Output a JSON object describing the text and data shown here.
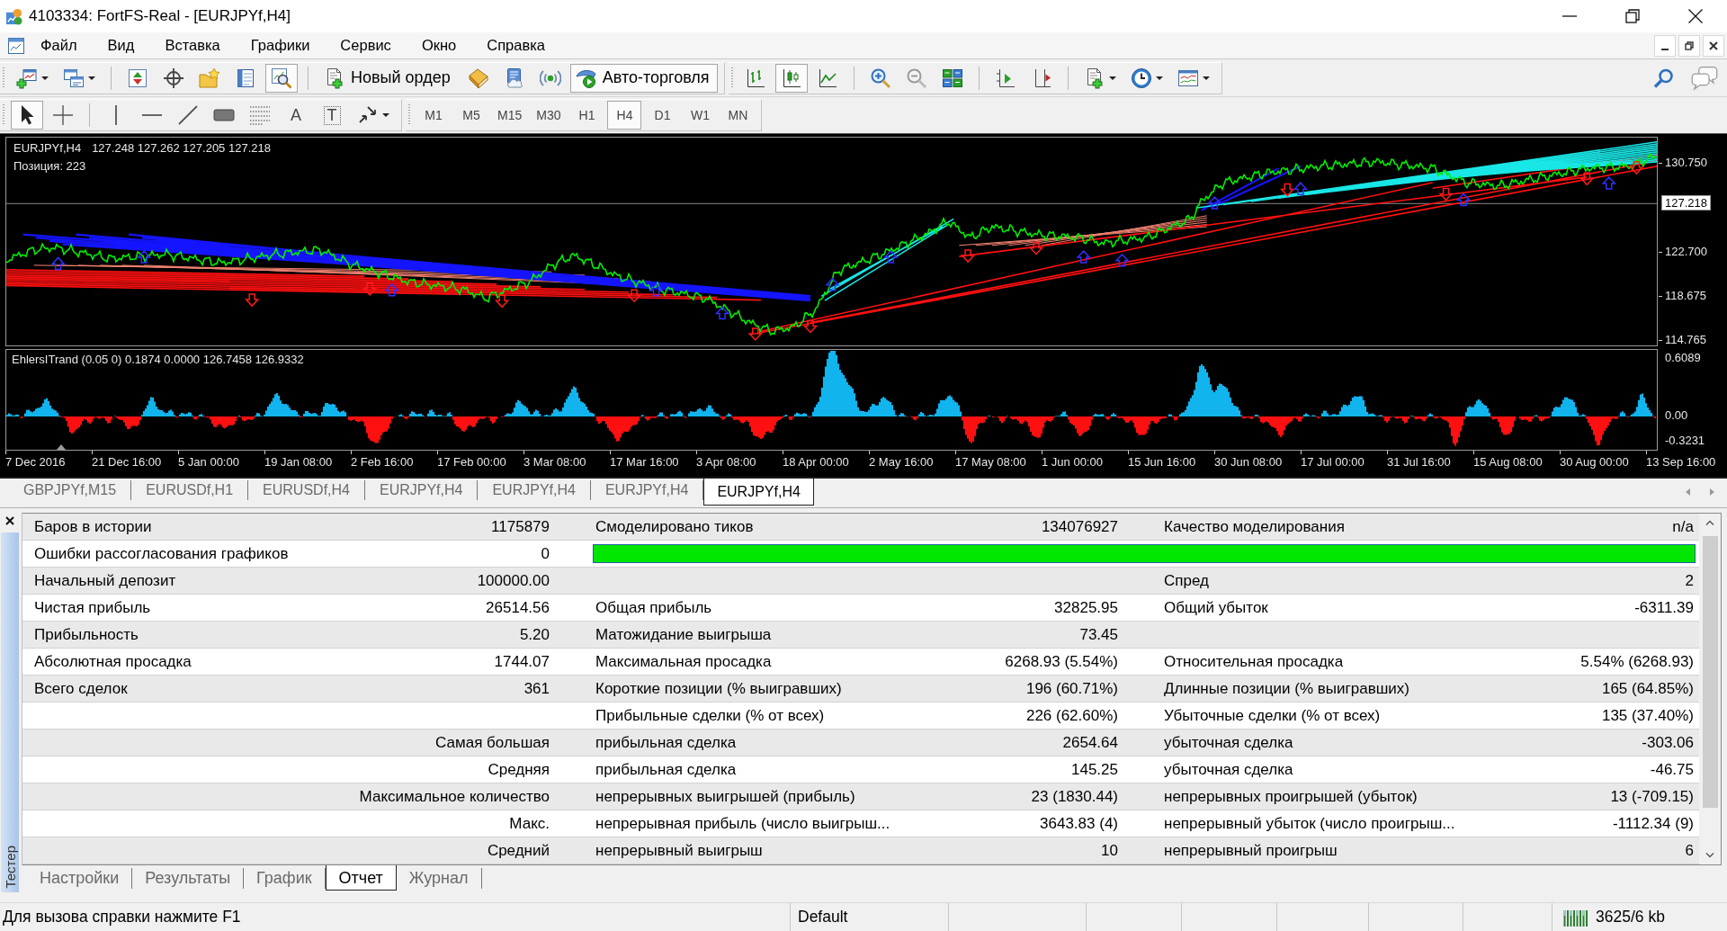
{
  "window": {
    "title": "4103334: FortFS-Real - [EURJPYf,H4]"
  },
  "menu": [
    "Файл",
    "Вид",
    "Вставка",
    "Графики",
    "Сервис",
    "Окно",
    "Справка"
  ],
  "toolbar_rows": [
    [
      {
        "groups": [
          [
            {
              "kind": "new_chart",
              "dropdown": true,
              "pressed": false
            },
            {
              "kind": "profiles",
              "dropdown": true,
              "pressed": false
            }
          ],
          [
            {
              "kind": "market_watch",
              "pressed": false
            },
            {
              "kind": "data_window",
              "pressed": false
            },
            {
              "kind": "navigator",
              "pressed": false
            },
            {
              "kind": "terminal",
              "pressed": false
            },
            {
              "kind": "tester",
              "pressed": true
            }
          ],
          [
            {
              "kind": "new_order",
              "label": "Новый ордер",
              "pressed": false
            },
            {
              "kind": "editor",
              "pressed": false
            },
            {
              "kind": "market",
              "pressed": false
            },
            {
              "kind": "signals",
              "pressed": false
            },
            {
              "kind": "auto_trading",
              "label": "Авто-торговля",
              "pressed": true
            }
          ]
        ]
      },
      {
        "groups": [
          [
            {
              "kind": "bar_chart",
              "pressed": false
            },
            {
              "kind": "candles",
              "pressed": true
            },
            {
              "kind": "line_chart",
              "pressed": false
            }
          ],
          [
            {
              "kind": "zoom_in",
              "pressed": false
            },
            {
              "kind": "zoom_out",
              "pressed": false
            },
            {
              "kind": "tile",
              "pressed": false
            }
          ],
          [
            {
              "kind": "chart_shift",
              "pressed": false
            },
            {
              "kind": "auto_scroll",
              "pressed": false
            }
          ],
          [
            {
              "kind": "indicators",
              "dropdown": true,
              "pressed": false
            },
            {
              "kind": "periods",
              "dropdown": true,
              "pressed": false
            },
            {
              "kind": "templates",
              "dropdown": true,
              "pressed": false
            }
          ]
        ]
      }
    ],
    [
      {
        "groups": [
          [
            {
              "kind": "cursor",
              "pressed": true
            },
            {
              "kind": "crosshair",
              "pressed": false
            }
          ],
          [
            {
              "kind": "vertical_line",
              "pressed": false
            },
            {
              "kind": "horizontal_line",
              "pressed": false
            },
            {
              "kind": "trend_line",
              "pressed": false
            },
            {
              "kind": "rectangle",
              "pressed": false
            },
            {
              "kind": "fibonacci",
              "pressed": false
            },
            {
              "kind": "text",
              "glyph": "A",
              "pressed": false
            },
            {
              "kind": "text_label",
              "glyph": "T",
              "pressed": false
            },
            {
              "kind": "arrows",
              "dropdown": true,
              "pressed": false
            }
          ]
        ]
      },
      {
        "groups": [
          [
            {
              "kind": "timeframe",
              "label": "M1",
              "selected": false
            },
            {
              "kind": "timeframe",
              "label": "M5",
              "selected": false
            },
            {
              "kind": "timeframe",
              "label": "M15",
              "selected": false
            },
            {
              "kind": "timeframe",
              "label": "M30",
              "selected": false
            },
            {
              "kind": "timeframe",
              "label": "H1",
              "selected": false
            },
            {
              "kind": "timeframe",
              "label": "H4",
              "selected": true
            },
            {
              "kind": "timeframe",
              "label": "D1",
              "selected": false
            },
            {
              "kind": "timeframe",
              "label": "W1",
              "selected": false
            },
            {
              "kind": "timeframe",
              "label": "MN",
              "selected": false
            }
          ]
        ]
      }
    ]
  ],
  "chart": {
    "symbol": "EURJPYf,H4",
    "quote": "127.248 127.262 127.205 127.218",
    "position": "Позиция: 223",
    "price_labels": [
      "130.750",
      "122.700",
      "118.675",
      "114.765"
    ],
    "current_price": "127.218",
    "indicator": {
      "label": "EhlersITrand (0.05 0) 0.1874 0.0000 126.7458 126.9332",
      "axis_labels": [
        "0.6089",
        "0.00",
        "-0.3231"
      ]
    },
    "time_labels": [
      "7 Dec 2016",
      "21 Dec 16:00",
      "5 Jan 00:00",
      "19 Jan 08:00",
      "2 Feb 16:00",
      "17 Feb 00:00",
      "3 Mar 08:00",
      "17 Mar 16:00",
      "3 Apr 08:00",
      "18 Apr 00:00",
      "2 May 16:00",
      "17 May 08:00",
      "1 Jun 00:00",
      "15 Jun 16:00",
      "30 Jun 08:00",
      "17 Jul 00:00",
      "31 Jul 16:00",
      "15 Aug 08:00",
      "30 Aug 00:00",
      "13 Sep 16:00"
    ]
  },
  "chart_tabs": [
    {
      "label": "GBPJPYf,M15",
      "selected": false
    },
    {
      "label": "EURUSDf,H1",
      "selected": false
    },
    {
      "label": "EURUSDf,H4",
      "selected": false
    },
    {
      "label": "EURJPYf,H4",
      "selected": false
    },
    {
      "label": "EURJPYf,H4",
      "selected": false
    },
    {
      "label": "EURJPYf,H4",
      "selected": false
    },
    {
      "label": "EURJPYf,H4",
      "selected": true
    }
  ],
  "tester": {
    "title": "Тестер",
    "report": {
      "rows": [
        {
          "col_1": {
            "label": "Баров в истории",
            "value": "1175879"
          },
          "col_2": {
            "label": "Смоделировано тиков",
            "value": "134076927"
          },
          "col_3": {
            "label": "Качество моделирования",
            "value": "n/a"
          }
        },
        {
          "col_1": {
            "label": "Ошибки рассогласования графиков",
            "value": "0"
          },
          "quality_bar": {
            "level": 1
          }
        },
        {
          "col_1": {
            "label": "Начальный депозит",
            "value": "100000.00"
          },
          "col_3": {
            "label": "Спред",
            "value": "2"
          }
        },
        {
          "col_1": {
            "label": "Чистая прибыль",
            "value": "26514.56"
          },
          "col_2": {
            "label": "Общая прибыль",
            "value": "32825.95"
          },
          "col_3": {
            "label": "Общий убыток",
            "value": "-6311.39"
          }
        },
        {
          "col_1": {
            "label": "Прибыльность",
            "value": "5.20"
          },
          "col_2": {
            "label": "Матожидание выигрыша",
            "value": "73.45"
          }
        },
        {
          "col_1": {
            "label": "Абсолютная просадка",
            "value": "1744.07"
          },
          "col_2": {
            "label": "Максимальная просадка",
            "value": "6268.93 (5.54%)"
          },
          "col_3": {
            "label": "Относительная просадка",
            "value": "5.54% (6268.93)"
          }
        },
        {
          "col_1": {
            "label": "Всего сделок",
            "value": "361"
          },
          "col_2": {
            "label": "Короткие позиции (% выигравших)",
            "value": "196 (60.71%)"
          },
          "col_3": {
            "label": "Длинные позиции (% выигравших)",
            "value": "165 (64.85%)"
          }
        },
        {
          "col_2": {
            "label": "Прибыльные сделки (% от всех)",
            "value": "226 (62.60%)"
          },
          "col_3": {
            "label": "Убыточные сделки (% от всех)",
            "value": "135 (37.40%)"
          }
        },
        {
          "caption": "Самая большая",
          "col_2": {
            "label": "прибыльная сделка",
            "value": "2654.64"
          },
          "col_3": {
            "label": "убыточная сделка",
            "value": "-303.06"
          }
        },
        {
          "caption": "Средняя",
          "col_2": {
            "label": "прибыльная сделка",
            "value": "145.25"
          },
          "col_3": {
            "label": "убыточная сделка",
            "value": "-46.75"
          }
        },
        {
          "caption": "Максимальное количество",
          "col_2": {
            "label": "непрерывных выигрышей (прибыль)",
            "value": "23 (1830.44)"
          },
          "col_3": {
            "label": "непрерывных проигрышей (убыток)",
            "value": "13 (-709.15)"
          }
        },
        {
          "caption": "Макс.",
          "col_2": {
            "label": "непрерывная прибыль (число выигрыш...",
            "value": "3643.83 (4)"
          },
          "col_3": {
            "label": "непрерывный убыток (число проигрыш...",
            "value": "-1112.34 (9)"
          }
        },
        {
          "caption": "Средний",
          "col_2": {
            "label": "непрерывный выигрыш",
            "value": "10"
          },
          "col_3": {
            "label": "непрерывный проигрыш",
            "value": "6"
          }
        }
      ]
    },
    "tabs": [
      {
        "label": "Настройки",
        "selected": false
      },
      {
        "label": "Результаты",
        "selected": false
      },
      {
        "label": "График",
        "selected": false
      },
      {
        "label": "Отчет",
        "selected": true
      },
      {
        "label": "Журнал",
        "selected": false
      }
    ]
  },
  "status_bar": {
    "help": "Для вызова справки нажмите F1",
    "profile": "Default",
    "traffic": "3625/6 kb"
  }
}
